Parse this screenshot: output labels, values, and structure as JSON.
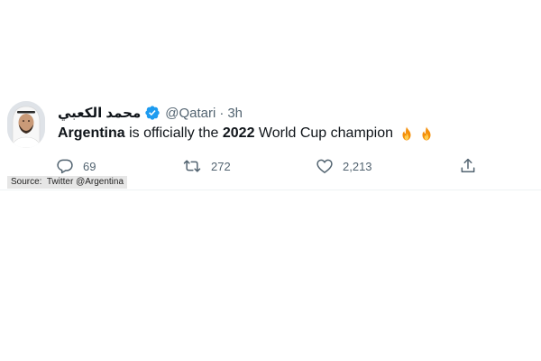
{
  "tweet": {
    "display_name": "محمد الكعبي",
    "handle": "@Qatari",
    "separator": "·",
    "time": "3h",
    "text_segments": [
      {
        "text": "Argentina",
        "bold": true
      },
      {
        "text": " is officially the ",
        "bold": false
      },
      {
        "text": "2022",
        "bold": true
      },
      {
        "text": " World Cup champion",
        "bold": false
      }
    ],
    "emoji": [
      "fire-emoji",
      "fire-emoji"
    ],
    "actions": {
      "reply_count": "69",
      "retweet_count": "272",
      "like_count": "2,213"
    },
    "icons": {
      "verified": "verified-badge-icon",
      "reply": "reply-icon",
      "retweet": "retweet-icon",
      "like": "heart-icon",
      "share": "share-icon"
    }
  },
  "source_caption": "Source:  Twitter @Argentina",
  "colors": {
    "verified_blue": "#1d9bf0",
    "muted_text": "#536471",
    "primary_text": "#0f1419"
  }
}
